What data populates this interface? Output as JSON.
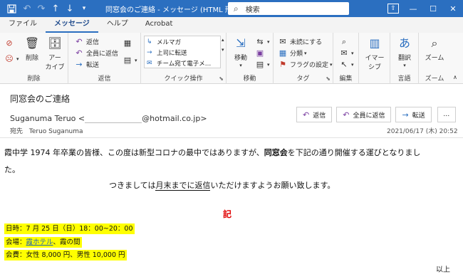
{
  "window": {
    "title": "同窓会のご連絡 - メッセージ (HTML 形式)",
    "search_placeholder": "検索"
  },
  "titlebar_icons": [
    "save-icon",
    "undo-icon",
    "redo-icon",
    "up-arrow-icon",
    "down-arrow-icon",
    "customize-icon"
  ],
  "window_controls": [
    "ribbon-display-icon",
    "minimize-icon",
    "maximize-icon",
    "close-icon"
  ],
  "tabs": [
    "ファイル",
    "メッセージ",
    "ヘルプ",
    "Acrobat"
  ],
  "active_tab": "メッセージ",
  "ribbon": {
    "delete_group": {
      "label": "削除",
      "delete_btn": "削除",
      "archive_btn_line1": "アー",
      "archive_btn_line2": "カイブ"
    },
    "respond_group": {
      "label": "返信",
      "reply": "返信",
      "reply_all": "全員に返信",
      "forward": "転送"
    },
    "quick_steps_group": {
      "label": "クイック操作",
      "items": [
        "メルマガ",
        "上司に転送",
        "チーム宛て電子メ…"
      ]
    },
    "move_group": {
      "label": "移動",
      "move_btn": "移動"
    },
    "tags_group": {
      "label": "タグ",
      "unread": "未読にする",
      "categorize": "分類",
      "flag": "フラグの設定"
    },
    "edit_group": {
      "label": "編集"
    },
    "immersive_group": {
      "label": "",
      "btn_line1": "イマー",
      "btn_line2": "シブ"
    },
    "language_group": {
      "label": "言語",
      "translate": "翻訳"
    },
    "zoom_group": {
      "label": "ズーム",
      "zoom_btn": "ズーム"
    }
  },
  "message": {
    "subject": "同窓会のご連絡",
    "sender_name": "Suganuma Teruo <",
    "sender_domain": "@hotmail.co.jp>",
    "to_label": "宛先",
    "to_name": "Teruo Suganuma",
    "date": "2021/06/17 (木) 20:52",
    "actions": {
      "reply": "返信",
      "reply_all": "全員に返信",
      "forward": "転送",
      "more": "…"
    }
  },
  "body": {
    "line1_a": "霞中学 1974 年卒業の皆様、この度は新型コロナの最中ではありますが、",
    "line1_bold": "同窓会",
    "line1_b": "を下記の通り開催する運びとなりまし",
    "line2": "た。",
    "line3_a": "つきましては",
    "line3_ul": "月末までに返信",
    "line3_b": "いただけますようお願い致します。",
    "ki": "記",
    "datetime": "日時：7 月 25 日（日）18：00~20：00",
    "venue_label": "会場：",
    "venue_link": "霞ホテル",
    "venue_rest": "、霞の間",
    "fee": "会費：女性 8,000 円、男性 10,000 円",
    "closing": "以上"
  }
}
